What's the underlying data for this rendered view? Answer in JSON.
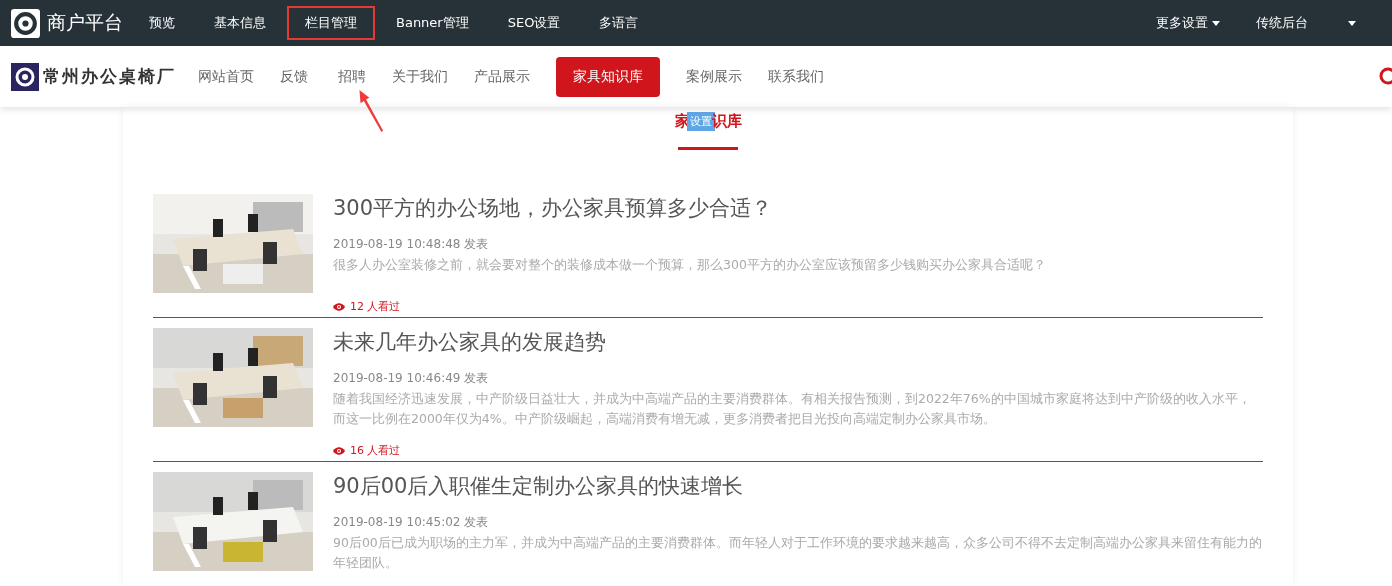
{
  "admin_bar": {
    "brand": "商户平台",
    "items": [
      {
        "label": "预览",
        "highlighted": false
      },
      {
        "label": "基本信息",
        "highlighted": false
      },
      {
        "label": "栏目管理",
        "highlighted": true
      },
      {
        "label": "Banner管理",
        "highlighted": false
      },
      {
        "label": "SEO设置",
        "highlighted": false
      },
      {
        "label": "多语言",
        "highlighted": false
      }
    ],
    "right_items": [
      {
        "label": "更多设置",
        "dropdown": true
      },
      {
        "label": "传统后台",
        "dropdown": false
      },
      {
        "dropdown": true
      }
    ]
  },
  "site_nav": {
    "logo": "常州办公桌椅厂",
    "items": [
      {
        "label": "网站首页",
        "selected": false
      },
      {
        "label": "反馈",
        "selected": false
      },
      {
        "label": "招聘",
        "selected": false
      },
      {
        "label": "关于我们",
        "selected": false
      },
      {
        "label": "产品展示",
        "selected": false
      },
      {
        "label": "家具知识库",
        "selected": true
      },
      {
        "label": "案例展示",
        "selected": false
      },
      {
        "label": "联系我们",
        "selected": false
      }
    ]
  },
  "section": {
    "heading_before": "家",
    "tooltip": "设置",
    "heading_after": "识库"
  },
  "articles": [
    {
      "title": "300平方的办公场地，办公家具预算多少合适？",
      "date": "2019-08-19 10:48:48 发表",
      "summary": "很多人办公室装修之前，就会要对整个的装修成本做一个预算，那么300平方的办公室应该预留多少钱购买办公家具合适呢？",
      "views": "12 人看过"
    },
    {
      "title": "未来几年办公家具的发展趋势",
      "date": "2019-08-19 10:46:49 发表",
      "summary": "随着我国经济迅速发展，中产阶级日益壮大，并成为中高端产品的主要消费群体。有相关报告预测，到2022年76%的中国城市家庭将达到中产阶级的收入水平，而这一比例在2000年仅为4%。中产阶级崛起，高端消费有增无减，更多消费者把目光投向高端定制办公家具市场。",
      "views": "16 人看过"
    },
    {
      "title": "90后00后入职催生定制办公家具的快速增长",
      "date": "2019-08-19 10:45:02 发表",
      "summary": "90后00后已成为职场的主力军，并成为中高端产品的主要消费群体。而年轻人对于工作环境的要求越来越高，众多公司不得不去定制高端办公家具来留住有能力的年轻团队。"
    }
  ]
}
